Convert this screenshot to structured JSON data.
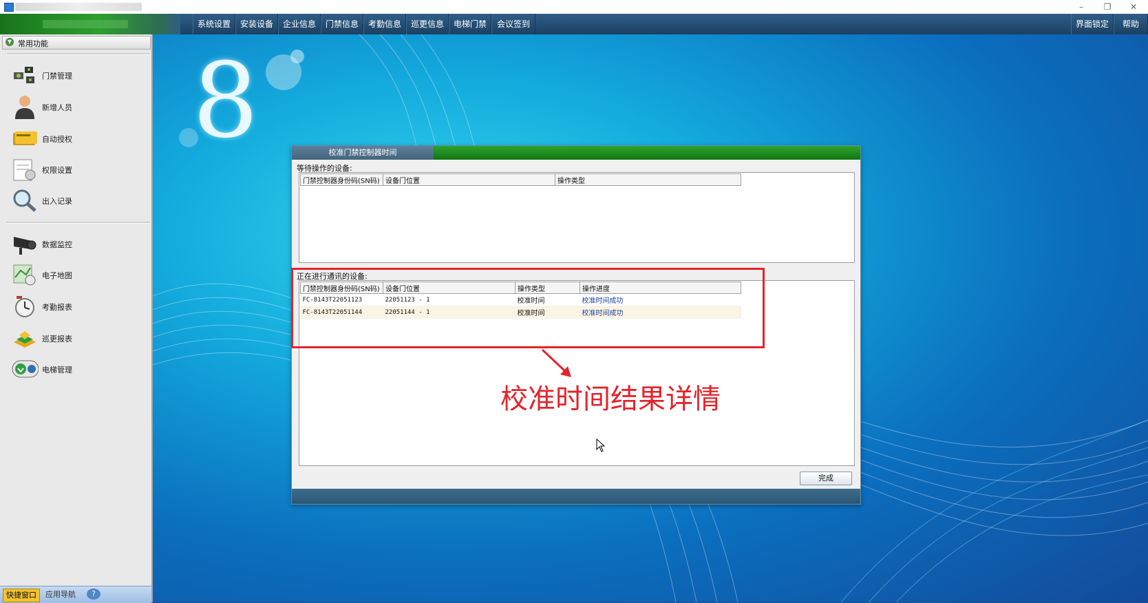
{
  "window": {
    "minimize": "–",
    "restore": "❐",
    "close": "✕"
  },
  "menu": {
    "items": [
      "系统设置",
      "安装设备",
      "企业信息",
      "门禁信息",
      "考勤信息",
      "巡更信息",
      "电梯门禁",
      "会议签到"
    ],
    "right_items": [
      "界面锁定",
      "帮助"
    ],
    "bg_color": "#244e74"
  },
  "sidebar": {
    "header": "常用功能",
    "items": [
      {
        "label": "门禁管理",
        "icon": "door-access-icon"
      },
      {
        "label": "新增人员",
        "icon": "person-icon"
      },
      {
        "label": "自动授权",
        "icon": "card-icon"
      },
      {
        "label": "权限设置",
        "icon": "permission-icon"
      },
      {
        "label": "出入记录",
        "icon": "magnifier-icon"
      },
      {
        "label": "数据监控",
        "icon": "camera-icon"
      },
      {
        "label": "电子地图",
        "icon": "map-icon"
      },
      {
        "label": "考勤报表",
        "icon": "clock-icon"
      },
      {
        "label": "巡更报表",
        "icon": "patrol-icon"
      },
      {
        "label": "电梯管理",
        "icon": "elevator-icon"
      }
    ]
  },
  "bottom_tabs": {
    "shortcut": "快捷窗口",
    "nav": "应用导航",
    "help": "?"
  },
  "logo": {
    "glyph": "8"
  },
  "dialog": {
    "title": "校准门禁控制器时间",
    "waiting_label": "等待操作的设备:",
    "waiting_columns": [
      "门禁控制器身份码(SN码)",
      "设备门位置",
      "操作类型"
    ],
    "active_label": "正在进行通讯的设备:",
    "active_columns": [
      "门禁控制器身份码(SN码)",
      "设备门位置",
      "操作类型",
      "操作进度"
    ],
    "active_rows": [
      [
        "FC-8143T22051123",
        "22051123 - 1",
        "校准时间",
        "校准时间成功"
      ],
      [
        "FC-8143T22051144",
        "22051144 - 1",
        "校准时间",
        "校准时间成功"
      ]
    ],
    "done_button": "完成"
  },
  "annotation": {
    "text": "校准时间结果详情",
    "color": "#e3242b"
  }
}
